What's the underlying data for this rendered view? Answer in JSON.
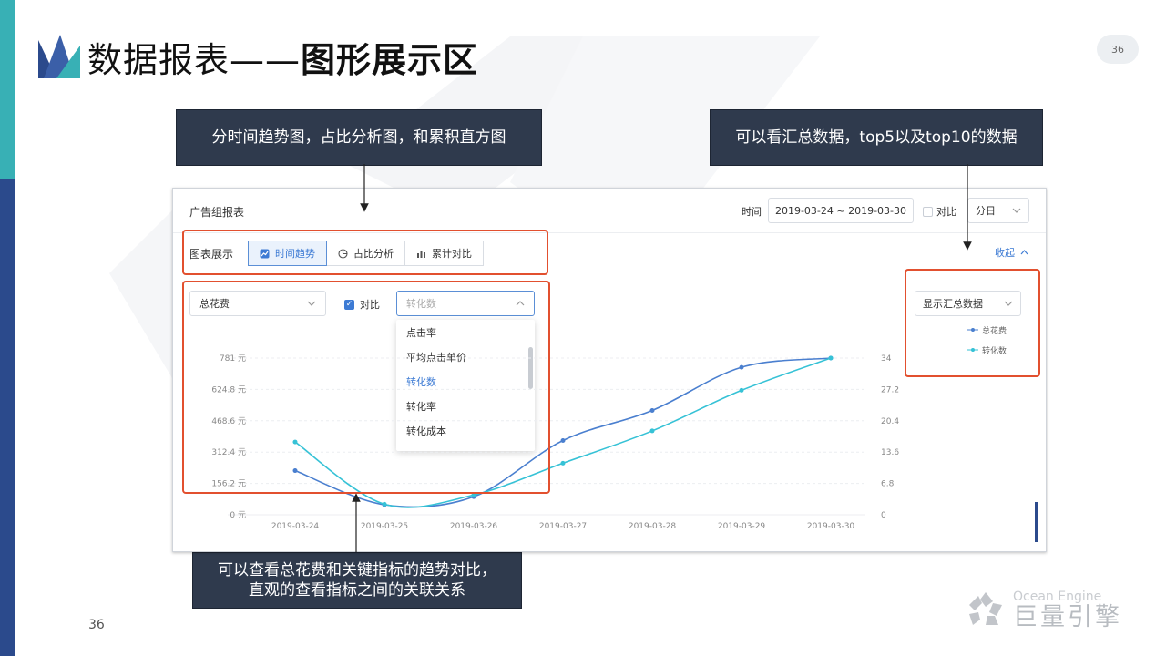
{
  "slide": {
    "title_regular": "数据报表——",
    "title_bold": "图形展示区",
    "page_badge": "36",
    "page_number": "36"
  },
  "callouts": {
    "top_left": "分时间趋势图，占比分析图，和累积直方图",
    "top_right": "可以看汇总数据，top5以及top10的数据",
    "bottom_line1": "可以查看总花费和关键指标的趋势对比，",
    "bottom_line2": "直观的查看指标之间的关联关系"
  },
  "panel": {
    "title": "广告组报表",
    "time_label": "时间",
    "date_range": "2019-03-24 ~ 2019-03-30",
    "compare_label": "对比",
    "granularity": "分日",
    "chart_display_label": "图表展示",
    "tabs": [
      {
        "label": "时间趋势",
        "icon": "trend-icon",
        "active": true
      },
      {
        "label": "占比分析",
        "icon": "pie-icon",
        "active": false
      },
      {
        "label": "累计对比",
        "icon": "bar-icon",
        "active": false
      }
    ],
    "collapse_label": "收起",
    "metric_select": "总花费",
    "compare_checked_label": "对比",
    "compare_select_placeholder": "转化数",
    "dropdown_options": [
      "点击率",
      "平均点击单价",
      "转化数",
      "转化率",
      "转化成本"
    ],
    "dropdown_selected": "转化数",
    "summary_select": "显示汇总数据",
    "legend": [
      "总花费",
      "转化数"
    ]
  },
  "chart_data": {
    "type": "line",
    "x": [
      "2019-03-24",
      "2019-03-25",
      "2019-03-26",
      "2019-03-27",
      "2019-03-28",
      "2019-03-29",
      "2019-03-30"
    ],
    "y_left_ticks": [
      "0 元",
      "156.2 元",
      "312.4 元",
      "468.6 元",
      "624.8 元",
      "781 元"
    ],
    "y_right_ticks": [
      "0",
      "6.8",
      "13.6",
      "20.4",
      "27.2",
      "34"
    ],
    "y_left_range": [
      0,
      781
    ],
    "y_right_range": [
      0,
      34
    ],
    "grid": true,
    "legend_position": "top-right",
    "series": [
      {
        "name": "总花费",
        "axis": "left",
        "color": "#4a7fcf",
        "values": [
          220,
          50,
          90,
          370,
          520,
          735,
          781
        ]
      },
      {
        "name": "转化数",
        "axis": "right",
        "color": "#36c2d6",
        "values": [
          15.8,
          2.3,
          4.3,
          11.2,
          18.2,
          27.0,
          34.0
        ]
      }
    ]
  },
  "brand": {
    "en": "Ocean Engine",
    "cn": "巨量引擎"
  },
  "colors": {
    "sidebar_teal": "#38b0b5",
    "sidebar_blue": "#2b4a8c",
    "callout_bg": "#2f3a4d",
    "highlight_red": "#e2502f",
    "accent_blue": "#3d7bd4"
  }
}
